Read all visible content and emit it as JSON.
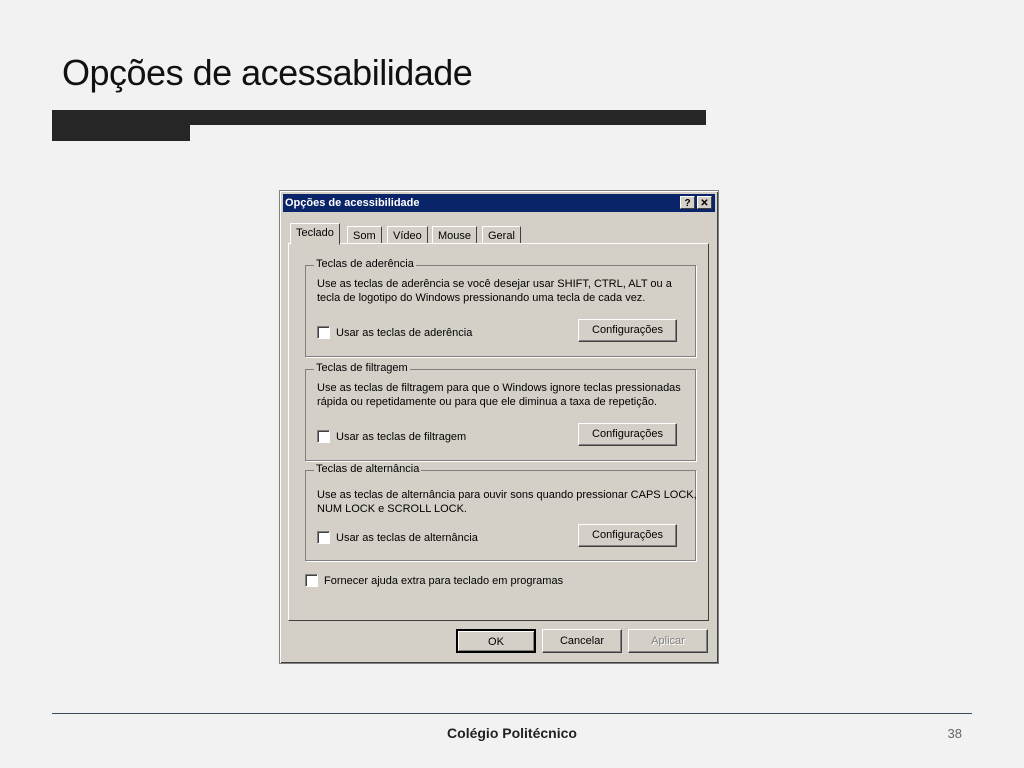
{
  "slide": {
    "title": "Opções de acessabilidade",
    "footer": "Colégio Politécnico",
    "page_number": "38"
  },
  "dialog": {
    "title": "Opções de acessibilidade",
    "help_label": "?",
    "close_label": "✕",
    "tabs": [
      "Teclado",
      "Som",
      "Vídeo",
      "Mouse",
      "Geral"
    ],
    "active_tab": "Teclado",
    "groups": [
      {
        "title": "Teclas de aderência",
        "description": "Use as teclas de aderência se você desejar usar SHIFT, CTRL, ALT ou a tecla de logotipo do Windows pressionando uma tecla de cada vez.",
        "checkbox_label": "Usar as teclas de aderência",
        "checked": false,
        "button_label": "Configurações"
      },
      {
        "title": "Teclas de filtragem",
        "description": "Use as teclas de filtragem para que o Windows ignore teclas pressionadas rápida ou repetidamente ou para que ele diminua a taxa de repetição.",
        "checkbox_label": "Usar as teclas de filtragem",
        "checked": false,
        "button_label": "Configurações"
      },
      {
        "title": "Teclas de alternância",
        "description": "Use as teclas de alternância para ouvir sons quando pressionar CAPS LOCK, NUM LOCK e SCROLL LOCK.",
        "checkbox_label": "Usar as teclas de alternância",
        "checked": false,
        "button_label": "Configurações"
      }
    ],
    "extra_checkbox_label": "Fornecer ajuda extra para teclado em programas",
    "buttons": {
      "ok": "OK",
      "cancel": "Cancelar",
      "apply": "Aplicar"
    }
  },
  "colors": {
    "titlebar": "#0a246a",
    "dialog_face": "#d4d0c8",
    "slide_bar": "#262626",
    "footer_line": "#3b4a63"
  }
}
